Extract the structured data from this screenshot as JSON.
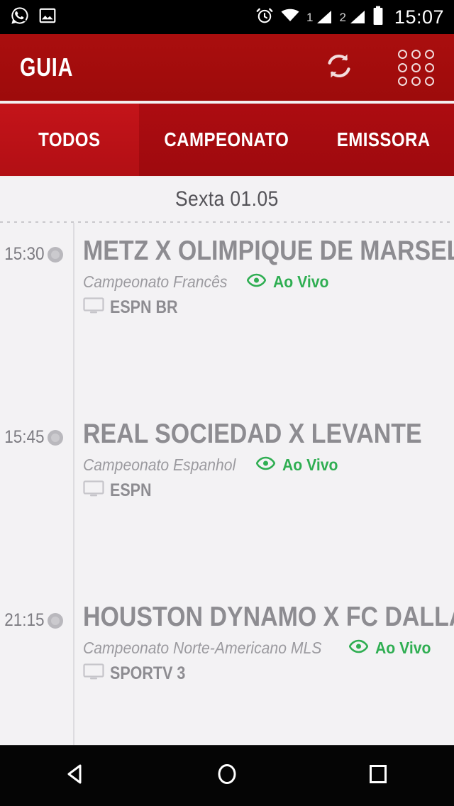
{
  "status_bar": {
    "time": "15:07",
    "left_icons": [
      "whatsapp-icon",
      "image-icon"
    ],
    "right_icons": [
      "alarm-icon",
      "wifi-icon",
      "signal-1-icon",
      "signal-2-icon",
      "battery-icon"
    ],
    "sim1_label": "1",
    "sim2_label": "2"
  },
  "app_bar": {
    "title": "GUIA",
    "refresh_label": "refresh-icon",
    "grid_label": "apps-grid-icon",
    "background_color": "#a50d0d"
  },
  "tabs": {
    "items": [
      {
        "label": "TODOS",
        "active": true
      },
      {
        "label": "CAMPEONATO",
        "active": false
      },
      {
        "label": "EMISSORA",
        "active": false
      }
    ],
    "active_color": "#bd1016",
    "inactive_color": "#a50a0f"
  },
  "content": {
    "date_header": "Sexta 01.05",
    "live_color": "#2fae52",
    "events": [
      {
        "time": "15:30",
        "title": "METZ X OLIMPIQUE DE MARSELHA",
        "league": "Campeonato Francês",
        "live": "Ao Vivo",
        "channel": "ESPN BR"
      },
      {
        "time": "15:45",
        "title": "REAL SOCIEDAD X LEVANTE",
        "league": "Campeonato Espanhol",
        "live": "Ao Vivo",
        "channel": "ESPN"
      },
      {
        "time": "21:15",
        "title": "HOUSTON DYNAMO X FC DALLAS",
        "league": "Campeonato Norte-Americano MLS",
        "live": "Ao Vivo",
        "channel": "SPORTV 3"
      }
    ]
  },
  "nav_bar": {
    "back_label": "back-icon",
    "home_label": "home-icon",
    "recents_label": "recents-icon"
  }
}
